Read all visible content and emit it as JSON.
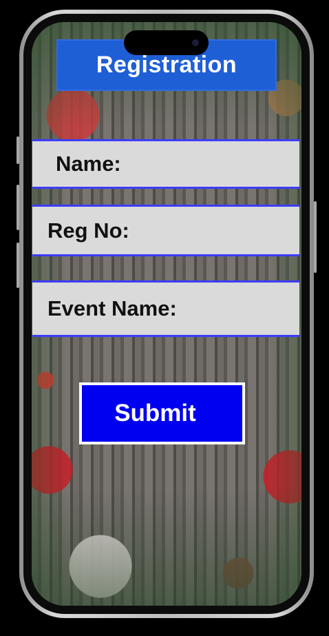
{
  "app": {
    "title": "Registration"
  },
  "form": {
    "fields": [
      {
        "label": "Name:"
      },
      {
        "label": "Reg No:"
      },
      {
        "label": "Event Name:"
      }
    ],
    "submit_label": "Submit"
  },
  "colors": {
    "title_bar": "#1f5fd6",
    "submit_button": "#0000f0",
    "field_background": "#dadada",
    "field_border": "#3c3cff"
  }
}
